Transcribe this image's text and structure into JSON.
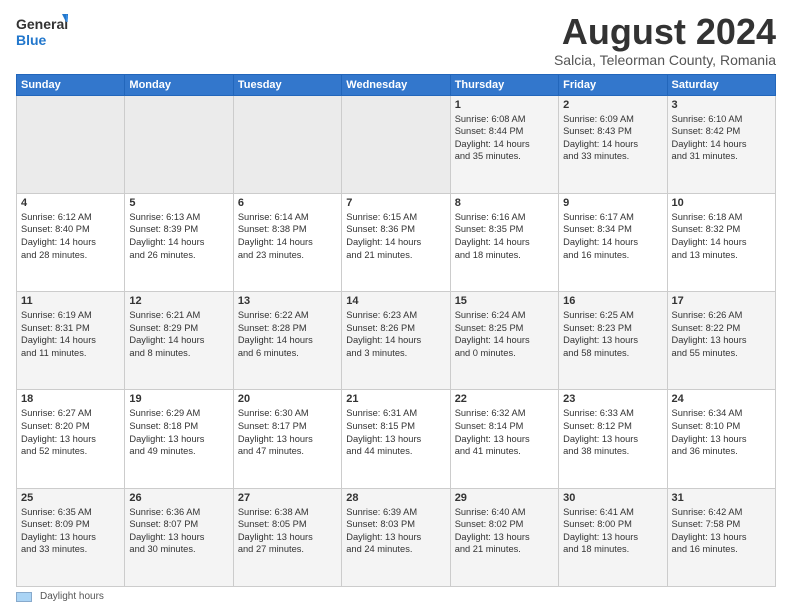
{
  "logo": {
    "general": "General",
    "blue": "Blue"
  },
  "header": {
    "month_year": "August 2024",
    "location": "Salcia, Teleorman County, Romania"
  },
  "days_of_week": [
    "Sunday",
    "Monday",
    "Tuesday",
    "Wednesday",
    "Thursday",
    "Friday",
    "Saturday"
  ],
  "footer": {
    "legend_label": "Daylight hours"
  },
  "weeks": [
    {
      "row_bg": "odd",
      "days": [
        {
          "num": "",
          "info": "",
          "empty": true
        },
        {
          "num": "",
          "info": "",
          "empty": true
        },
        {
          "num": "",
          "info": "",
          "empty": true
        },
        {
          "num": "",
          "info": "",
          "empty": true
        },
        {
          "num": "1",
          "info": "Sunrise: 6:08 AM\nSunset: 8:44 PM\nDaylight: 14 hours\nand 35 minutes.",
          "empty": false
        },
        {
          "num": "2",
          "info": "Sunrise: 6:09 AM\nSunset: 8:43 PM\nDaylight: 14 hours\nand 33 minutes.",
          "empty": false
        },
        {
          "num": "3",
          "info": "Sunrise: 6:10 AM\nSunset: 8:42 PM\nDaylight: 14 hours\nand 31 minutes.",
          "empty": false
        }
      ]
    },
    {
      "row_bg": "even",
      "days": [
        {
          "num": "4",
          "info": "Sunrise: 6:12 AM\nSunset: 8:40 PM\nDaylight: 14 hours\nand 28 minutes.",
          "empty": false
        },
        {
          "num": "5",
          "info": "Sunrise: 6:13 AM\nSunset: 8:39 PM\nDaylight: 14 hours\nand 26 minutes.",
          "empty": false
        },
        {
          "num": "6",
          "info": "Sunrise: 6:14 AM\nSunset: 8:38 PM\nDaylight: 14 hours\nand 23 minutes.",
          "empty": false
        },
        {
          "num": "7",
          "info": "Sunrise: 6:15 AM\nSunset: 8:36 PM\nDaylight: 14 hours\nand 21 minutes.",
          "empty": false
        },
        {
          "num": "8",
          "info": "Sunrise: 6:16 AM\nSunset: 8:35 PM\nDaylight: 14 hours\nand 18 minutes.",
          "empty": false
        },
        {
          "num": "9",
          "info": "Sunrise: 6:17 AM\nSunset: 8:34 PM\nDaylight: 14 hours\nand 16 minutes.",
          "empty": false
        },
        {
          "num": "10",
          "info": "Sunrise: 6:18 AM\nSunset: 8:32 PM\nDaylight: 14 hours\nand 13 minutes.",
          "empty": false
        }
      ]
    },
    {
      "row_bg": "odd",
      "days": [
        {
          "num": "11",
          "info": "Sunrise: 6:19 AM\nSunset: 8:31 PM\nDaylight: 14 hours\nand 11 minutes.",
          "empty": false
        },
        {
          "num": "12",
          "info": "Sunrise: 6:21 AM\nSunset: 8:29 PM\nDaylight: 14 hours\nand 8 minutes.",
          "empty": false
        },
        {
          "num": "13",
          "info": "Sunrise: 6:22 AM\nSunset: 8:28 PM\nDaylight: 14 hours\nand 6 minutes.",
          "empty": false
        },
        {
          "num": "14",
          "info": "Sunrise: 6:23 AM\nSunset: 8:26 PM\nDaylight: 14 hours\nand 3 minutes.",
          "empty": false
        },
        {
          "num": "15",
          "info": "Sunrise: 6:24 AM\nSunset: 8:25 PM\nDaylight: 14 hours\nand 0 minutes.",
          "empty": false
        },
        {
          "num": "16",
          "info": "Sunrise: 6:25 AM\nSunset: 8:23 PM\nDaylight: 13 hours\nand 58 minutes.",
          "empty": false
        },
        {
          "num": "17",
          "info": "Sunrise: 6:26 AM\nSunset: 8:22 PM\nDaylight: 13 hours\nand 55 minutes.",
          "empty": false
        }
      ]
    },
    {
      "row_bg": "even",
      "days": [
        {
          "num": "18",
          "info": "Sunrise: 6:27 AM\nSunset: 8:20 PM\nDaylight: 13 hours\nand 52 minutes.",
          "empty": false
        },
        {
          "num": "19",
          "info": "Sunrise: 6:29 AM\nSunset: 8:18 PM\nDaylight: 13 hours\nand 49 minutes.",
          "empty": false
        },
        {
          "num": "20",
          "info": "Sunrise: 6:30 AM\nSunset: 8:17 PM\nDaylight: 13 hours\nand 47 minutes.",
          "empty": false
        },
        {
          "num": "21",
          "info": "Sunrise: 6:31 AM\nSunset: 8:15 PM\nDaylight: 13 hours\nand 44 minutes.",
          "empty": false
        },
        {
          "num": "22",
          "info": "Sunrise: 6:32 AM\nSunset: 8:14 PM\nDaylight: 13 hours\nand 41 minutes.",
          "empty": false
        },
        {
          "num": "23",
          "info": "Sunrise: 6:33 AM\nSunset: 8:12 PM\nDaylight: 13 hours\nand 38 minutes.",
          "empty": false
        },
        {
          "num": "24",
          "info": "Sunrise: 6:34 AM\nSunset: 8:10 PM\nDaylight: 13 hours\nand 36 minutes.",
          "empty": false
        }
      ]
    },
    {
      "row_bg": "odd",
      "days": [
        {
          "num": "25",
          "info": "Sunrise: 6:35 AM\nSunset: 8:09 PM\nDaylight: 13 hours\nand 33 minutes.",
          "empty": false
        },
        {
          "num": "26",
          "info": "Sunrise: 6:36 AM\nSunset: 8:07 PM\nDaylight: 13 hours\nand 30 minutes.",
          "empty": false
        },
        {
          "num": "27",
          "info": "Sunrise: 6:38 AM\nSunset: 8:05 PM\nDaylight: 13 hours\nand 27 minutes.",
          "empty": false
        },
        {
          "num": "28",
          "info": "Sunrise: 6:39 AM\nSunset: 8:03 PM\nDaylight: 13 hours\nand 24 minutes.",
          "empty": false
        },
        {
          "num": "29",
          "info": "Sunrise: 6:40 AM\nSunset: 8:02 PM\nDaylight: 13 hours\nand 21 minutes.",
          "empty": false
        },
        {
          "num": "30",
          "info": "Sunrise: 6:41 AM\nSunset: 8:00 PM\nDaylight: 13 hours\nand 18 minutes.",
          "empty": false
        },
        {
          "num": "31",
          "info": "Sunrise: 6:42 AM\nSunset: 7:58 PM\nDaylight: 13 hours\nand 16 minutes.",
          "empty": false
        }
      ]
    }
  ]
}
